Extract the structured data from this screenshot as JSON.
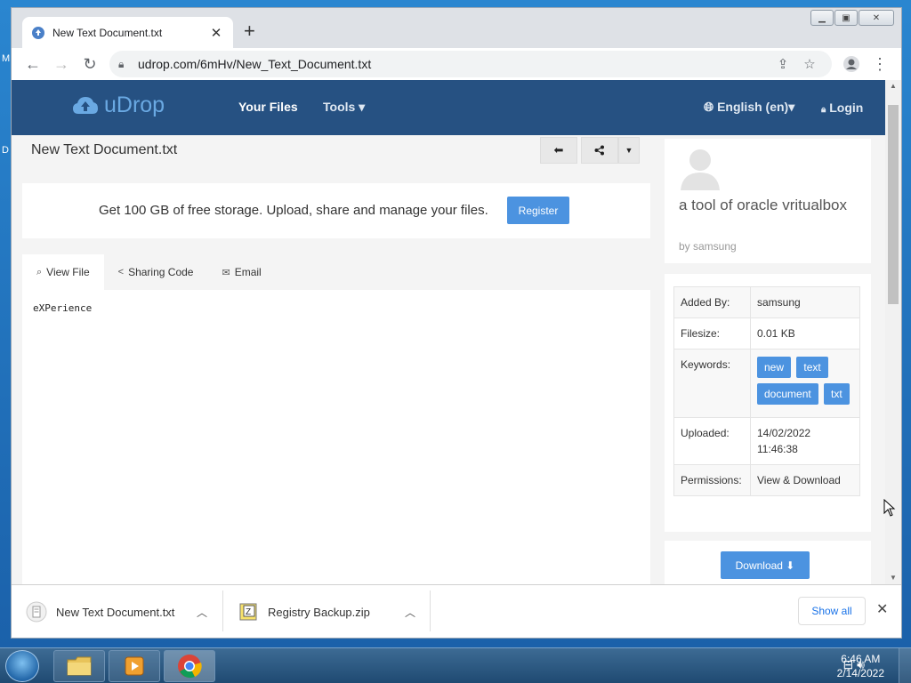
{
  "desktop": {
    "side_letters": [
      "M",
      "D"
    ]
  },
  "browser": {
    "tab_title": "New Text Document.txt",
    "tab_close": "✕",
    "new_tab": "+",
    "url": "udrop.com/6mHv/New_Text_Document.txt"
  },
  "site": {
    "logo_text": "uDrop",
    "nav_files": "Your Files",
    "nav_tools": "Tools ▾",
    "nav_lang": "English (en)▾",
    "nav_login": "Login"
  },
  "file": {
    "title": "New Text Document.txt",
    "promo_text": "Get 100 GB of free storage. Upload, share and manage your files.",
    "register_label": "Register",
    "tabs": [
      {
        "label": "View File",
        "icon": "⌕"
      },
      {
        "label": "Sharing Code",
        "icon": "<"
      },
      {
        "label": "Email",
        "icon": "✉"
      }
    ],
    "content": "eXPerience"
  },
  "sidebar": {
    "description": "a tool of oracle vritualbox",
    "by": "by samsung",
    "info": {
      "added_by_label": "Added By:",
      "added_by": "samsung",
      "filesize_label": "Filesize:",
      "filesize": "0.01 KB",
      "keywords_label": "Keywords:",
      "keywords": [
        "new",
        "text",
        "document",
        "txt"
      ],
      "uploaded_label": "Uploaded:",
      "uploaded_date": "14/02/2022",
      "uploaded_time": "11:46:38",
      "permissions_label": "Permissions:",
      "permissions": "View & Download"
    },
    "download_label": "Download ⬇"
  },
  "shelf": {
    "items": [
      {
        "name": "New Text Document.txt"
      },
      {
        "name": "Registry Backup.zip"
      }
    ],
    "show_all": "Show all"
  },
  "taskbar": {
    "time": "6:46 AM",
    "date": "2/14/2022"
  },
  "colors": {
    "header_bg": "#265182",
    "accent_blue": "#4c93e0",
    "logo_blue": "#6aa9e3"
  }
}
